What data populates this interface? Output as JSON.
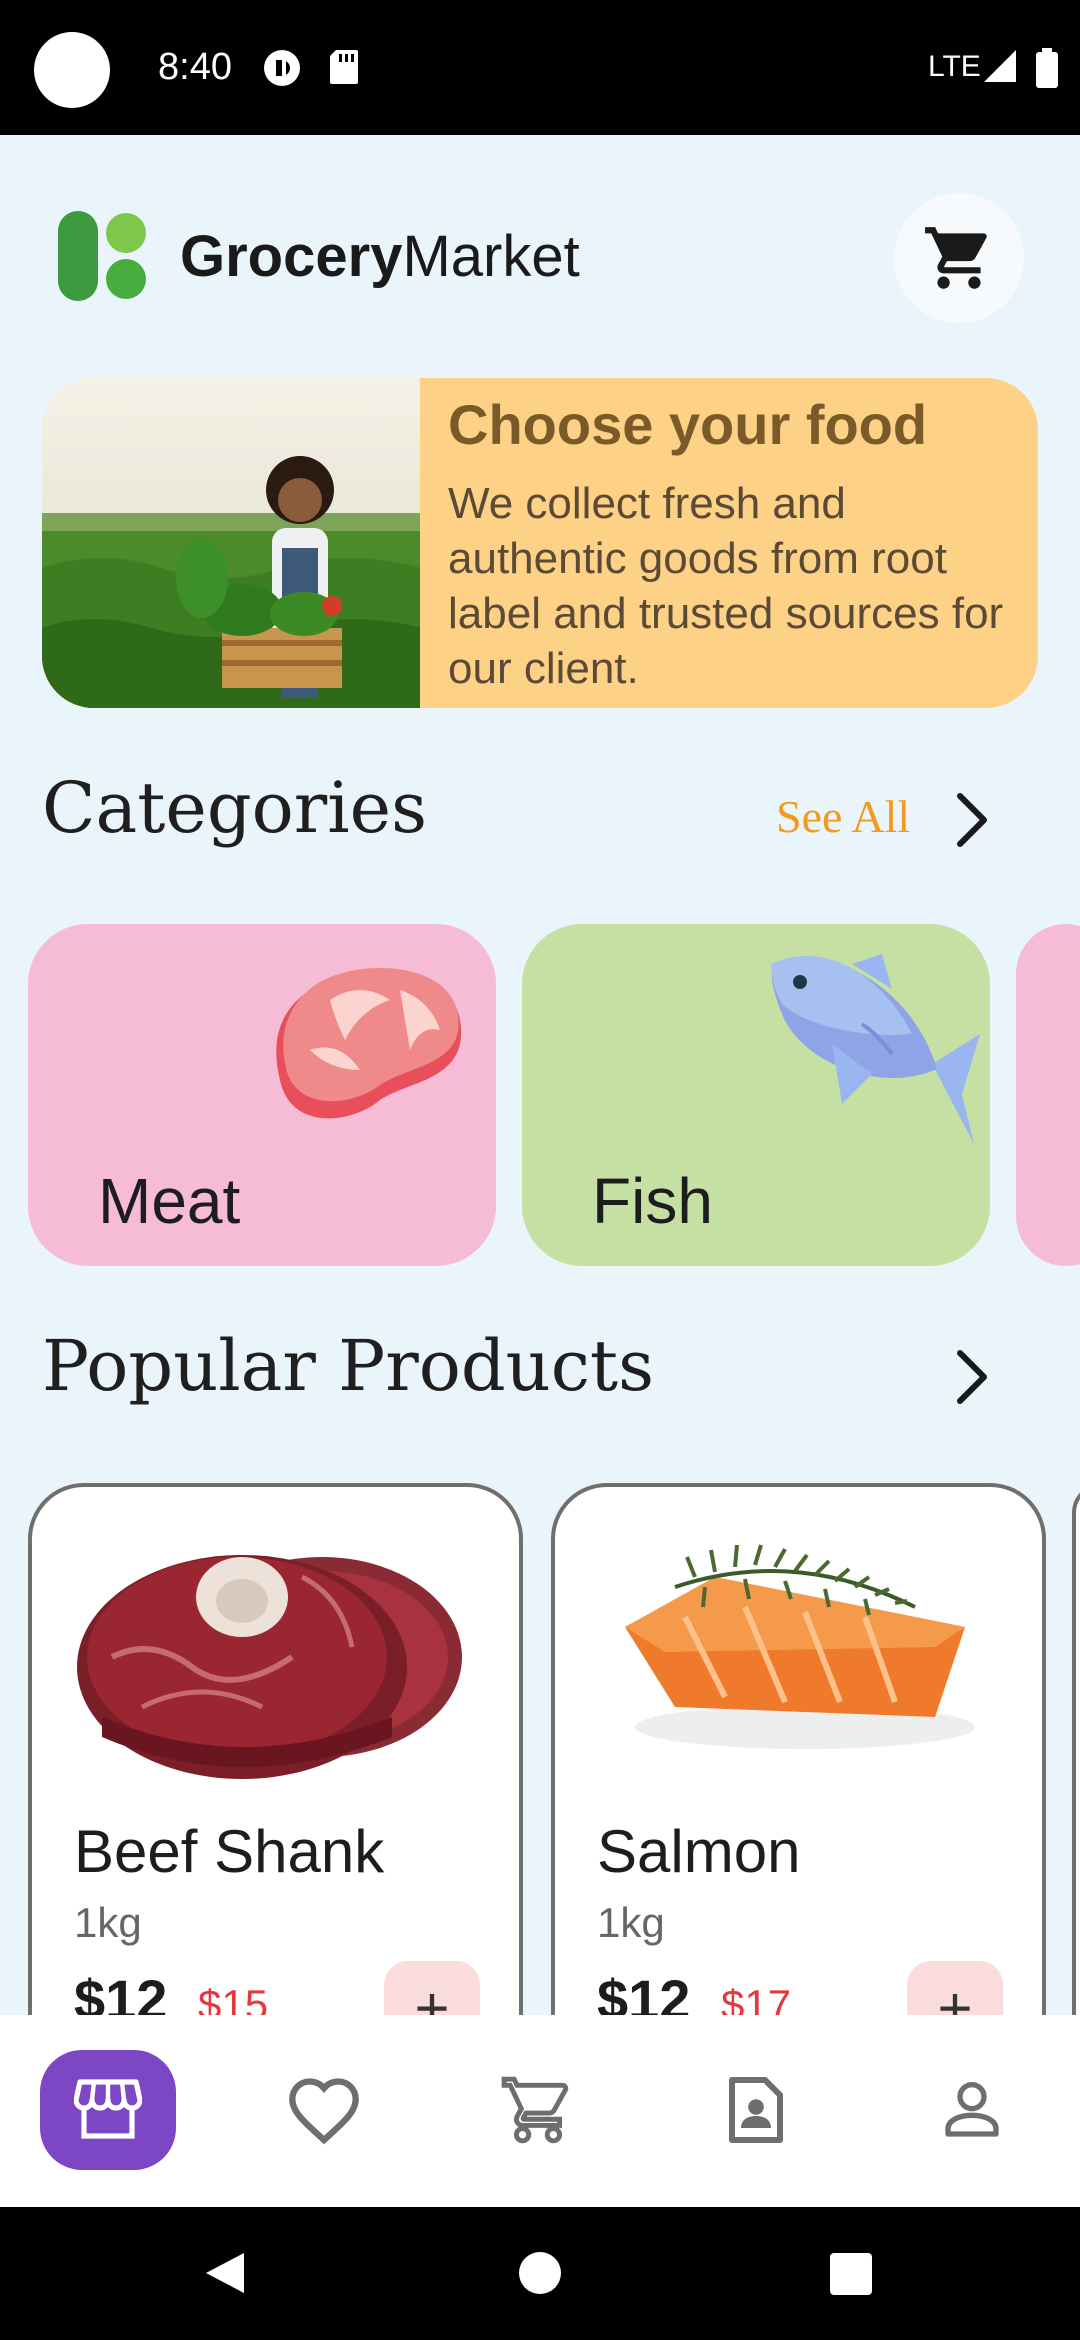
{
  "status_bar": {
    "time": "8:40",
    "network": "LTE"
  },
  "header": {
    "brand_bold": "Grocery",
    "brand_light": "Market",
    "cart_icon": "cart-icon"
  },
  "banner": {
    "title": "Choose your food",
    "text": "We collect fresh and authentic goods from root label and trusted sources for our client."
  },
  "categories": {
    "title": "Categories",
    "see_all": "See All",
    "items": [
      {
        "label": "Meat",
        "color": "#f6bcd6"
      },
      {
        "label": "Fish",
        "color": "#c6e0a3"
      }
    ]
  },
  "popular": {
    "title": "Popular Products",
    "items": [
      {
        "name": "Beef Shank",
        "unit": "1kg",
        "price": "$12",
        "old_price": "$15"
      },
      {
        "name": "Salmon",
        "unit": "1kg",
        "price": "$12",
        "old_price": "$17"
      }
    ]
  },
  "bottom_nav": {
    "items": [
      {
        "icon": "store-icon",
        "active": true
      },
      {
        "icon": "heart-icon",
        "active": false
      },
      {
        "icon": "cart-icon",
        "active": false
      },
      {
        "icon": "contact-icon",
        "active": false
      },
      {
        "icon": "profile-icon",
        "active": false
      }
    ]
  },
  "colors": {
    "accent": "#7d46c4",
    "banner_bg": "#fdd186",
    "see_all": "#f29a1c",
    "old_price": "#e2383e",
    "screen_bg": "#eaf4fb"
  }
}
